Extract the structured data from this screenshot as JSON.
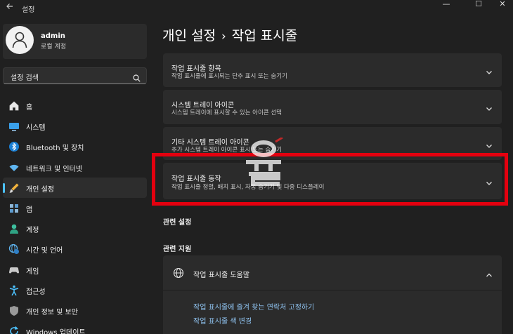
{
  "window": {
    "title": "설정",
    "minimize_symbol": "—",
    "maximize_symbol": "☐",
    "close_symbol": "✕"
  },
  "profile": {
    "name": "admin",
    "account_type": "로컬 계정"
  },
  "search": {
    "placeholder": "설정 검색"
  },
  "sidebar": {
    "items": [
      {
        "label": "홈",
        "icon": "home-icon"
      },
      {
        "label": "시스템",
        "icon": "display-icon"
      },
      {
        "label": "Bluetooth 및 장치",
        "icon": "bluetooth-icon"
      },
      {
        "label": "네트워크 및 인터넷",
        "icon": "wifi-icon"
      },
      {
        "label": "개인 설정",
        "icon": "brush-icon",
        "active": true
      },
      {
        "label": "앱",
        "icon": "apps-icon"
      },
      {
        "label": "계정",
        "icon": "person-icon"
      },
      {
        "label": "시간 및 언어",
        "icon": "globe-clock-icon"
      },
      {
        "label": "게임",
        "icon": "gamepad-icon"
      },
      {
        "label": "접근성",
        "icon": "accessibility-icon"
      },
      {
        "label": "개인 정보 및 보안",
        "icon": "shield-icon"
      },
      {
        "label": "Windows 업데이트",
        "icon": "update-icon"
      }
    ]
  },
  "breadcrumb": {
    "parent": "개인 설정",
    "separator": "›",
    "current": "작업 표시줄"
  },
  "cards": [
    {
      "title": "작업 표시줄 항목",
      "description": "작업 표시줄에 표시되는 단추 표시 또는 숨기기"
    },
    {
      "title": "시스템 트레이 아이콘",
      "description": "시스템 트레이에 표시할 수 있는 아이콘 선택"
    },
    {
      "title": "기타 시스템 트레이 아이콘",
      "description": "추가 시스템 트레이 아이콘 표시 또는 숨기기"
    },
    {
      "title": "작업 표시줄 동작",
      "description": "작업 표시줄 정렬, 배지 표시, 자동 숨기기 및 다중 디스플레이"
    }
  ],
  "related_settings": {
    "label": "관련 설정"
  },
  "related_support": {
    "label": "관련 지원",
    "help_title": "작업 표시줄 도움말",
    "links": [
      "작업 표시줄에 즐겨 찾는 연락처 고정하기",
      "작업 표시줄 색 변경"
    ]
  },
  "colors": {
    "accent": "#4cc2ff",
    "highlight_box": "#e4000f",
    "link": "#8fc3f0",
    "card": "#2b2b2b",
    "background": "#202020"
  }
}
